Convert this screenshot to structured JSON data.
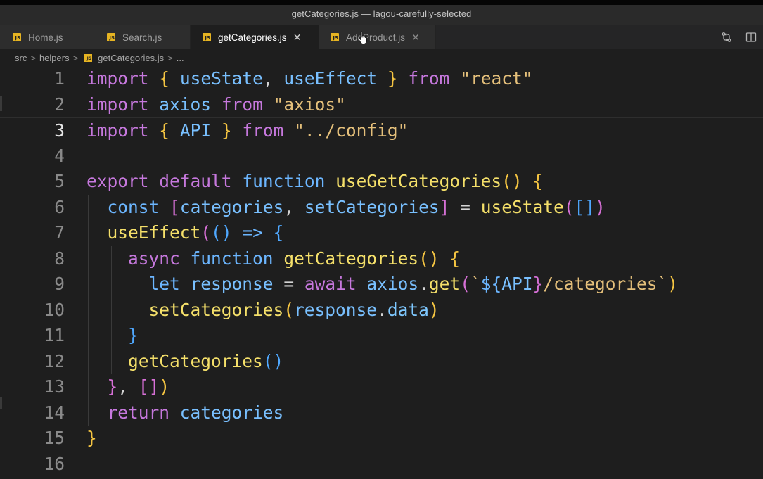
{
  "window": {
    "title": "getCategories.js — lagou-carefully-selected"
  },
  "tabs": [
    {
      "label": "Home.js",
      "icon": "js-file-icon",
      "active": false
    },
    {
      "label": "Search.js",
      "icon": "js-file-icon",
      "active": false
    },
    {
      "label": "getCategories.js",
      "icon": "js-file-icon",
      "active": true
    },
    {
      "label": "AddProduct.js",
      "icon": "js-file-icon",
      "active": false
    }
  ],
  "tab_actions": [
    {
      "icon": "compare-changes-icon"
    },
    {
      "icon": "split-editor-icon"
    }
  ],
  "breadcrumb": {
    "parts": [
      "src",
      "helpers",
      "getCategories.js",
      "..."
    ],
    "separator": ">"
  },
  "editor": {
    "active_line": 3,
    "lines": [
      {
        "n": "1"
      },
      {
        "n": "2"
      },
      {
        "n": "3"
      },
      {
        "n": "4"
      },
      {
        "n": "5"
      },
      {
        "n": "6"
      },
      {
        "n": "7"
      },
      {
        "n": "8"
      },
      {
        "n": "9"
      },
      {
        "n": "10"
      },
      {
        "n": "11"
      },
      {
        "n": "12"
      },
      {
        "n": "13"
      },
      {
        "n": "14"
      },
      {
        "n": "15"
      },
      {
        "n": "16"
      }
    ],
    "code": [
      "import { useState, useEffect } from \"react\"",
      "import axios from \"axios\"",
      "import { API } from \"../config\"",
      "",
      "export default function useGetCategories() {",
      "  const [categories, setCategories] = useState([])",
      "  useEffect(() => {",
      "    async function getCategories() {",
      "      let response = await axios.get(`${API}/categories`)",
      "      setCategories(response.data)",
      "    }",
      "    getCategories()",
      "  }, [])",
      "  return categories",
      "}",
      ""
    ]
  },
  "colors": {
    "background": "#1e1e1e",
    "keyword": "#c678dd",
    "storage": "#6cb6ff",
    "function": "#f5e06a",
    "string": "#e5c07b",
    "variable": "#79c0ff",
    "js_icon": "#e6b422"
  }
}
